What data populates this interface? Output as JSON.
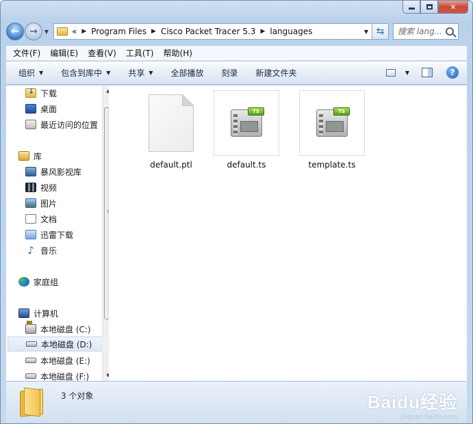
{
  "window": {
    "buttons": {
      "minimize": "",
      "maximize": "",
      "close": "✕"
    }
  },
  "address": {
    "overflow": "«",
    "crumbs": [
      "Program Files",
      "Cisco Packet Tracer 5.3",
      "languages"
    ]
  },
  "search": {
    "placeholder": "搜索 lang..."
  },
  "menu": [
    "文件(F)",
    "编辑(E)",
    "查看(V)",
    "工具(T)",
    "帮助(H)"
  ],
  "toolbar": {
    "organize": "组织",
    "include_library": "包含到库中",
    "share": "共享",
    "play_all": "全部播放",
    "burn": "刻录",
    "new_folder": "新建文件夹"
  },
  "nav": {
    "favorites": [
      "下载",
      "桌面",
      "最近访问的位置"
    ],
    "library_header": "库",
    "libraries": [
      "暴风影视库",
      "视频",
      "图片",
      "文档",
      "迅雷下载",
      "音乐"
    ],
    "homegroup": "家庭组",
    "computer": "计算机",
    "drives": [
      "本地磁盘 (C:)",
      "本地磁盘 (D:)",
      "本地磁盘 (E:)",
      "本地磁盘 (F:)"
    ],
    "selected_drive": "本地磁盘 (D:)"
  },
  "files": [
    {
      "name": "default.ptl",
      "icon": "blank-file-icon"
    },
    {
      "name": "default.ts",
      "icon": "ts-file-icon",
      "badge": "TS"
    },
    {
      "name": "template.ts",
      "icon": "ts-file-icon",
      "badge": "TS"
    }
  ],
  "status": {
    "count": "3 个对象"
  },
  "watermark": {
    "main": "Baidu经验",
    "sub": "jingyan.baidu.com"
  }
}
